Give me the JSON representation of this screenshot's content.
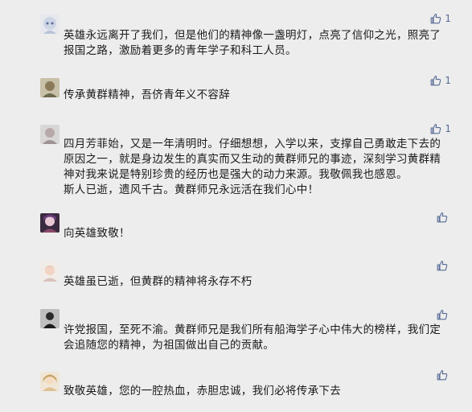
{
  "comments": [
    {
      "text": "英雄永远离开了我们，但是他们的精神像一盏明灯，点亮了信仰之光，照亮了报国之路，激励着更多的青年学子和科工人员。",
      "likes": "1"
    },
    {
      "text": "传承黄群精神，吾侪青年义不容辞",
      "likes": "1"
    },
    {
      "text": "四月芳菲始，又是一年清明时。仔细想想，入学以来，支撑自己勇敢走下去的原因之一，就是身边发生的真实而又生动的黄群师兄的事迹，深刻学习黄群精神对我来说是特别珍贵的经历也是强大的动力来源。我敬佩我也感恩。",
      "text2": "斯人已逝，遗风千古。黄群师兄永远活在我们心中！",
      "likes": "1"
    },
    {
      "text": "向英雄致敬！",
      "likes": ""
    },
    {
      "text": "英雄虽已逝，但黄群的精神将永存不朽",
      "likes": ""
    },
    {
      "text": "许党报国，至死不渝。黄群师兄是我们所有船海学子心中伟大的榜样，我们定会追随您的精神，为祖国做出自己的贡献。",
      "likes": ""
    },
    {
      "text": "致敬英雄，您的一腔热血，赤胆忠诚，我们必将传承下去",
      "likes": ""
    }
  ],
  "colors": {
    "background": "#ededed",
    "like": "#576b95"
  },
  "icons": {
    "like": "thumbs-up-icon",
    "avatar": "user-avatar"
  }
}
